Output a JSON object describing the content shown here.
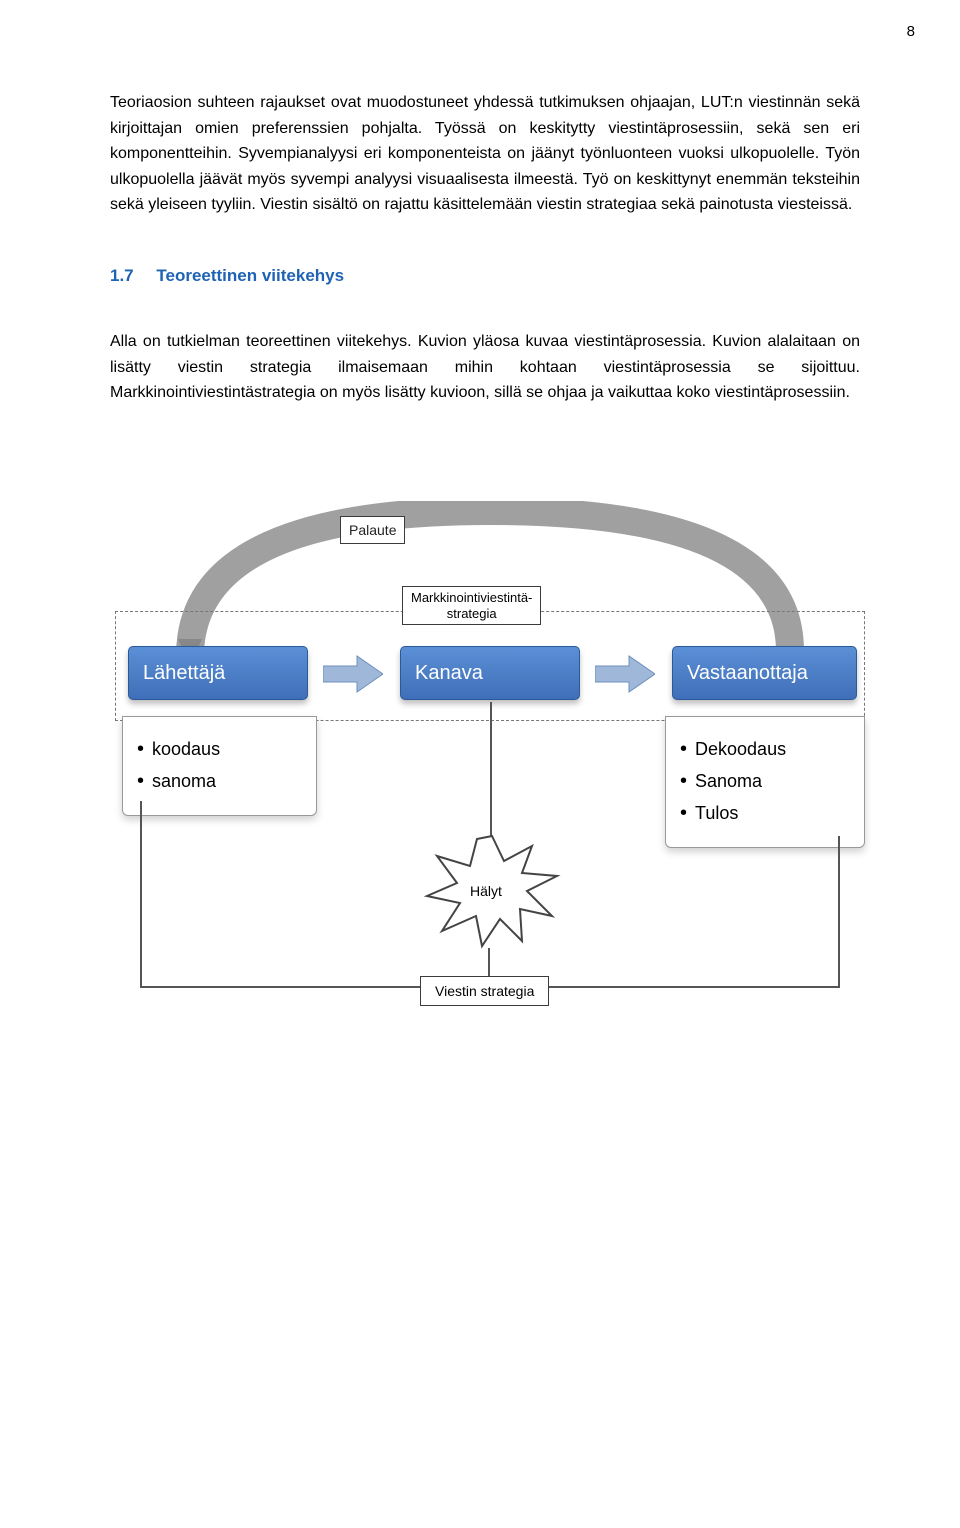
{
  "pageNumber": "8",
  "paragraph1": "Teoriaosion suhteen rajaukset ovat muodostuneet yhdessä tutkimuksen ohjaajan, LUT:n viestinnän sekä kirjoittajan omien preferenssien pohjalta. Työssä on keskitytty viestintäprosessiin, sekä sen eri komponentteihin. Syvempianalyysi eri komponenteista on jäänyt työnluonteen vuoksi ulkopuolelle. Työn ulkopuolella jäävät myös syvempi analyysi visuaalisesta ilmeestä. Työ on keskittynyt enemmän teksteihin sekä yleiseen tyyliin. Viestin sisältö on rajattu käsittelemään viestin strategiaa sekä painotusta viesteissä.",
  "section": {
    "number": "1.7",
    "title": "Teoreettinen viitekehys"
  },
  "paragraph2": "Alla on tutkielman teoreettinen viitekehys. Kuvion yläosa kuvaa viestintäprosessia. Kuvion alalaitaan on lisätty viestin strategia ilmaisemaan mihin kohtaan viestintäprosessia se sijoittuu. Markkinointiviestintästrategia on myös lisätty kuvioon, sillä se ohjaa ja vaikuttaa koko viestintäprosessiin.",
  "diagram": {
    "palaute": "Palaute",
    "strategy_line1": "Markkinointiviestintä-",
    "strategy_line2": "strategia",
    "node_lahettaja": "Lähettäjä",
    "node_kanava": "Kanava",
    "node_vastaanottaja": "Vastaanottaja",
    "bullets_lahettaja": {
      "b1": "koodaus",
      "b2": "sanoma"
    },
    "bullets_vastaanottaja": {
      "b1": "Dekoodaus",
      "b2": "Sanoma",
      "b3": "Tulos"
    },
    "halyt": "Hälyt",
    "viestin_strategia": "Viestin strategia"
  }
}
